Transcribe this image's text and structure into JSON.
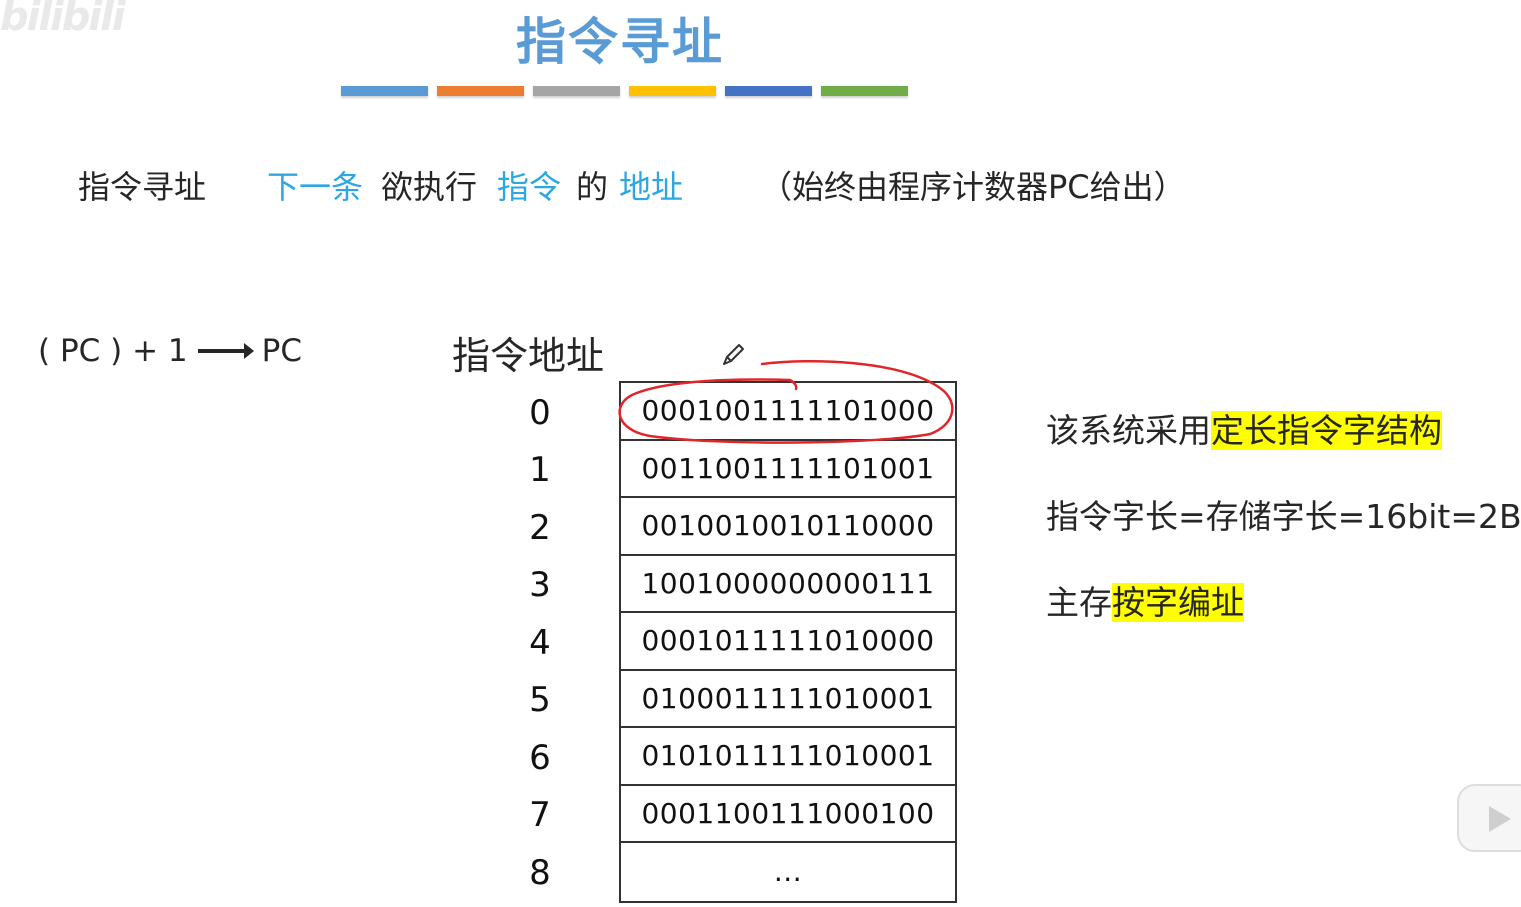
{
  "watermark": "bilibili",
  "title": "指令寻址",
  "color_bars": [
    "#5b9bd5",
    "#ed7d31",
    "#a5a5a5",
    "#ffc000",
    "#4472c4",
    "#70ad47"
  ],
  "definition": {
    "term": "指令寻址",
    "part1": "下一条",
    "part2": "欲执行",
    "part3": "指令",
    "part4": "的",
    "part5": "地址",
    "note": "（始终由程序计数器PC给出）"
  },
  "pc_formula": {
    "lhs": "( PC ) + 1",
    "rhs": "PC"
  },
  "memory": {
    "header": "指令地址",
    "rows": [
      {
        "addr": "0",
        "content": "0001001111101000"
      },
      {
        "addr": "1",
        "content": "0011001111101001"
      },
      {
        "addr": "2",
        "content": "0010010010110000"
      },
      {
        "addr": "3",
        "content": "1001000000000111"
      },
      {
        "addr": "4",
        "content": "0001011111010000"
      },
      {
        "addr": "5",
        "content": "0100011111010001"
      },
      {
        "addr": "6",
        "content": "0101011111010001"
      },
      {
        "addr": "7",
        "content": "0001100111000100"
      },
      {
        "addr": "8",
        "content": "..."
      }
    ]
  },
  "notes": {
    "line1_prefix": "该系统采用",
    "line1_highlight": "定长指令字结构",
    "line2": "指令字长=存储字长=16bit=2B",
    "line3_prefix": "主存",
    "line3_highlight": "按字编址"
  },
  "annotation_color": "#e0262a",
  "highlight_color": "#ffff00"
}
